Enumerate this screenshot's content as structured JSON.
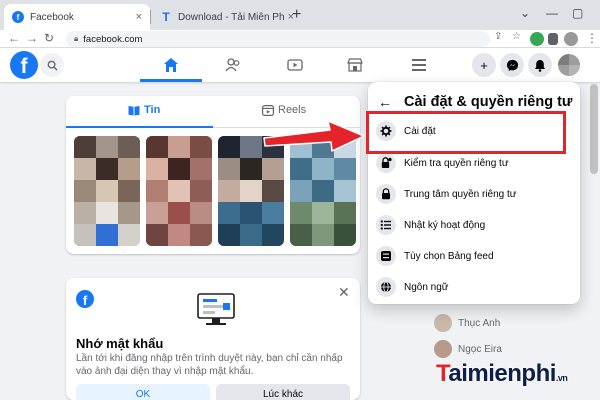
{
  "browser": {
    "tabs": [
      {
        "title": "Facebook",
        "icon": "facebook-favicon",
        "active": true
      },
      {
        "title": "Download - Tải Miễn Phí VN - P",
        "icon": "taimienphi-favicon",
        "active": false
      }
    ],
    "close_glyph": "×",
    "new_tab_glyph": "+",
    "url": "facebook.com",
    "window_controls": [
      "⌄",
      "—",
      "▢"
    ]
  },
  "fb_header": {
    "logo_letter": "f",
    "nav_icons": [
      "home-icon",
      "friends-icon",
      "watch-icon",
      "marketplace-icon",
      "menu-icon"
    ],
    "right_icons": [
      "plus-icon",
      "messenger-icon",
      "notifications-icon"
    ]
  },
  "stories": {
    "tab_stories": "Tin",
    "tab_reels": "Reels"
  },
  "password_card": {
    "title": "Nhớ mật khẩu",
    "body": "Lần tới khi đăng nhập trên trình duyệt này, bạn chỉ cần nhấp vào ảnh đại diện thay vì nhập mật khẩu.",
    "ok_label": "OK",
    "later_label": "Lúc khác"
  },
  "dropdown": {
    "title": "Cài đặt & quyền riêng tư",
    "back_glyph": "←",
    "items": [
      {
        "label": "Cài đặt",
        "icon": "gear-icon"
      },
      {
        "label": "Kiểm tra quyền riêng tư",
        "icon": "lock-check-icon"
      },
      {
        "label": "Trung tâm quyền riêng tư",
        "icon": "lock-icon"
      },
      {
        "label": "Nhật ký hoạt động",
        "icon": "list-icon"
      },
      {
        "label": "Tùy chọn Bảng feed",
        "icon": "feed-preferences-icon"
      },
      {
        "label": "Ngôn ngữ",
        "icon": "globe-icon"
      }
    ]
  },
  "contacts": [
    {
      "name": "Thục Anh"
    },
    {
      "name": "Ngọc Eira"
    }
  ],
  "watermark": {
    "t": "T",
    "rest": "aimienphi",
    "suffix": ".vn"
  },
  "colors": {
    "fb_blue": "#1877f2",
    "highlight_red": "#e3242b",
    "bg": "#f0f2f5"
  }
}
